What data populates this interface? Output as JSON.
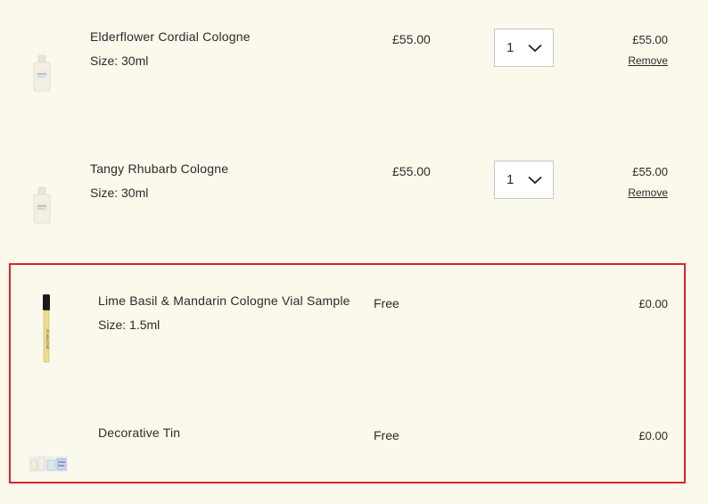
{
  "cart": {
    "items": [
      {
        "name": "Elderflower Cordial Cologne",
        "size": "Size: 30ml",
        "price": "£55.00",
        "quantity": "1",
        "total": "£55.00",
        "remove_label": "Remove",
        "image_icon": "cologne-bottle-icon"
      },
      {
        "name": "Tangy Rhubarb Cologne",
        "size": "Size: 30ml",
        "price": "£55.00",
        "quantity": "1",
        "total": "£55.00",
        "remove_label": "Remove",
        "image_icon": "cologne-bottle-icon"
      }
    ],
    "free_items": [
      {
        "name": "Lime Basil & Mandarin Cologne Vial Sample",
        "size": "Size: 1.5ml",
        "price": "Free",
        "total": "£0.00",
        "image_icon": "vial-sample-icon"
      },
      {
        "name": "Decorative Tin",
        "price": "Free",
        "total": "£0.00",
        "image_icon": "decorative-tin-icon"
      }
    ]
  },
  "colors": {
    "background": "#fbf8ec",
    "highlight_border": "#d9262a"
  }
}
